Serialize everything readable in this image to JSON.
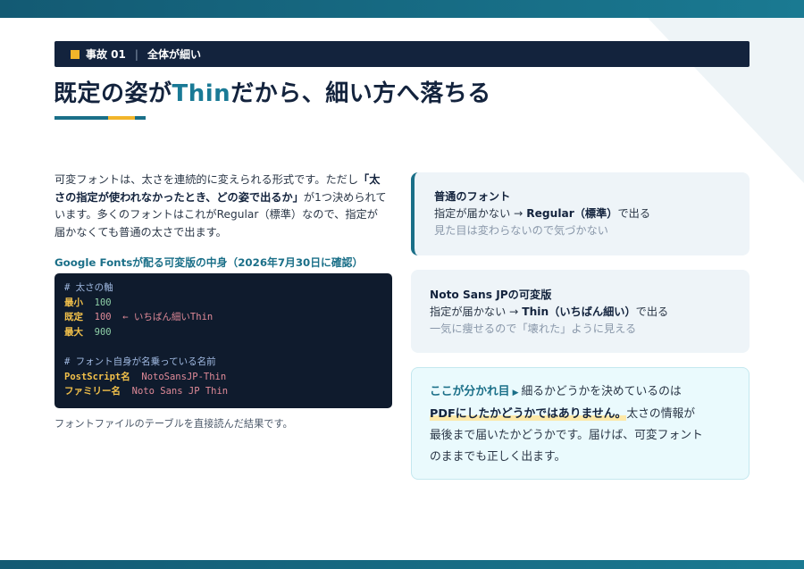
{
  "section": {
    "number": "事故 01",
    "label": "全体が細い"
  },
  "title": {
    "before": "既定の姿が",
    "accent": "Thin",
    "after": "だから、細い方へ落ちる"
  },
  "intro": {
    "part1": "可変フォントは、太さを連続的に変えられる形式です。ただし",
    "bold": "「太さの指定が使われなかったとき、どの姿で出るか」",
    "part2": "が1つ決められています。多くのフォントはこれがRegular（標準）なので、指定が届かなくても普通の太さで出ます。"
  },
  "code_caption": "Google Fontsが配る可変版の中身（2026年7月30日に確認）",
  "code": {
    "comment_axis": "# 太さの軸",
    "min_key": "最小",
    "min_val": "100",
    "default_key": "既定",
    "default_val": "100",
    "default_note": "← いちばん細いThin",
    "max_key": "最大",
    "max_val": "900",
    "comment_name": "# フォント自身が名乗っている名前",
    "ps_key": "PostScript名",
    "ps_val": "NotoSansJP-Thin",
    "family_key": "ファミリー名",
    "family_val": "Noto Sans JP Thin"
  },
  "code_note": "フォントファイルのテーブルを直接読んだ結果です。",
  "card_regular": {
    "title": "普通のフォント",
    "line_prefix": "指定が届かない → ",
    "line_bold": "Regular（標準）",
    "line_suffix": "で出る",
    "sub": "見た目は変わらないので気づかない"
  },
  "card_noto": {
    "title": "Noto Sans JPの可変版",
    "line_prefix": "指定が届かない → ",
    "line_bold": "Thin（いちばん細い）",
    "line_suffix": "で出る",
    "sub": "一気に痩せるので「壊れた」ように見える"
  },
  "card_key": {
    "label": "ここが分かれ目",
    "line1": "細るかどうかを決めているのは",
    "highlight": "PDFにしたかどうかではありません。",
    "line2_suffix": "太さの情報が",
    "line3": "最後まで届いたかどうかです。届けば、可変フォント",
    "line4": "のままでも正しく出ます。"
  },
  "colors": {
    "navy": "#13233d",
    "teal": "#1a7a96",
    "accent_yellow": "#f2b52a",
    "code_bg": "#0f1b2d"
  }
}
